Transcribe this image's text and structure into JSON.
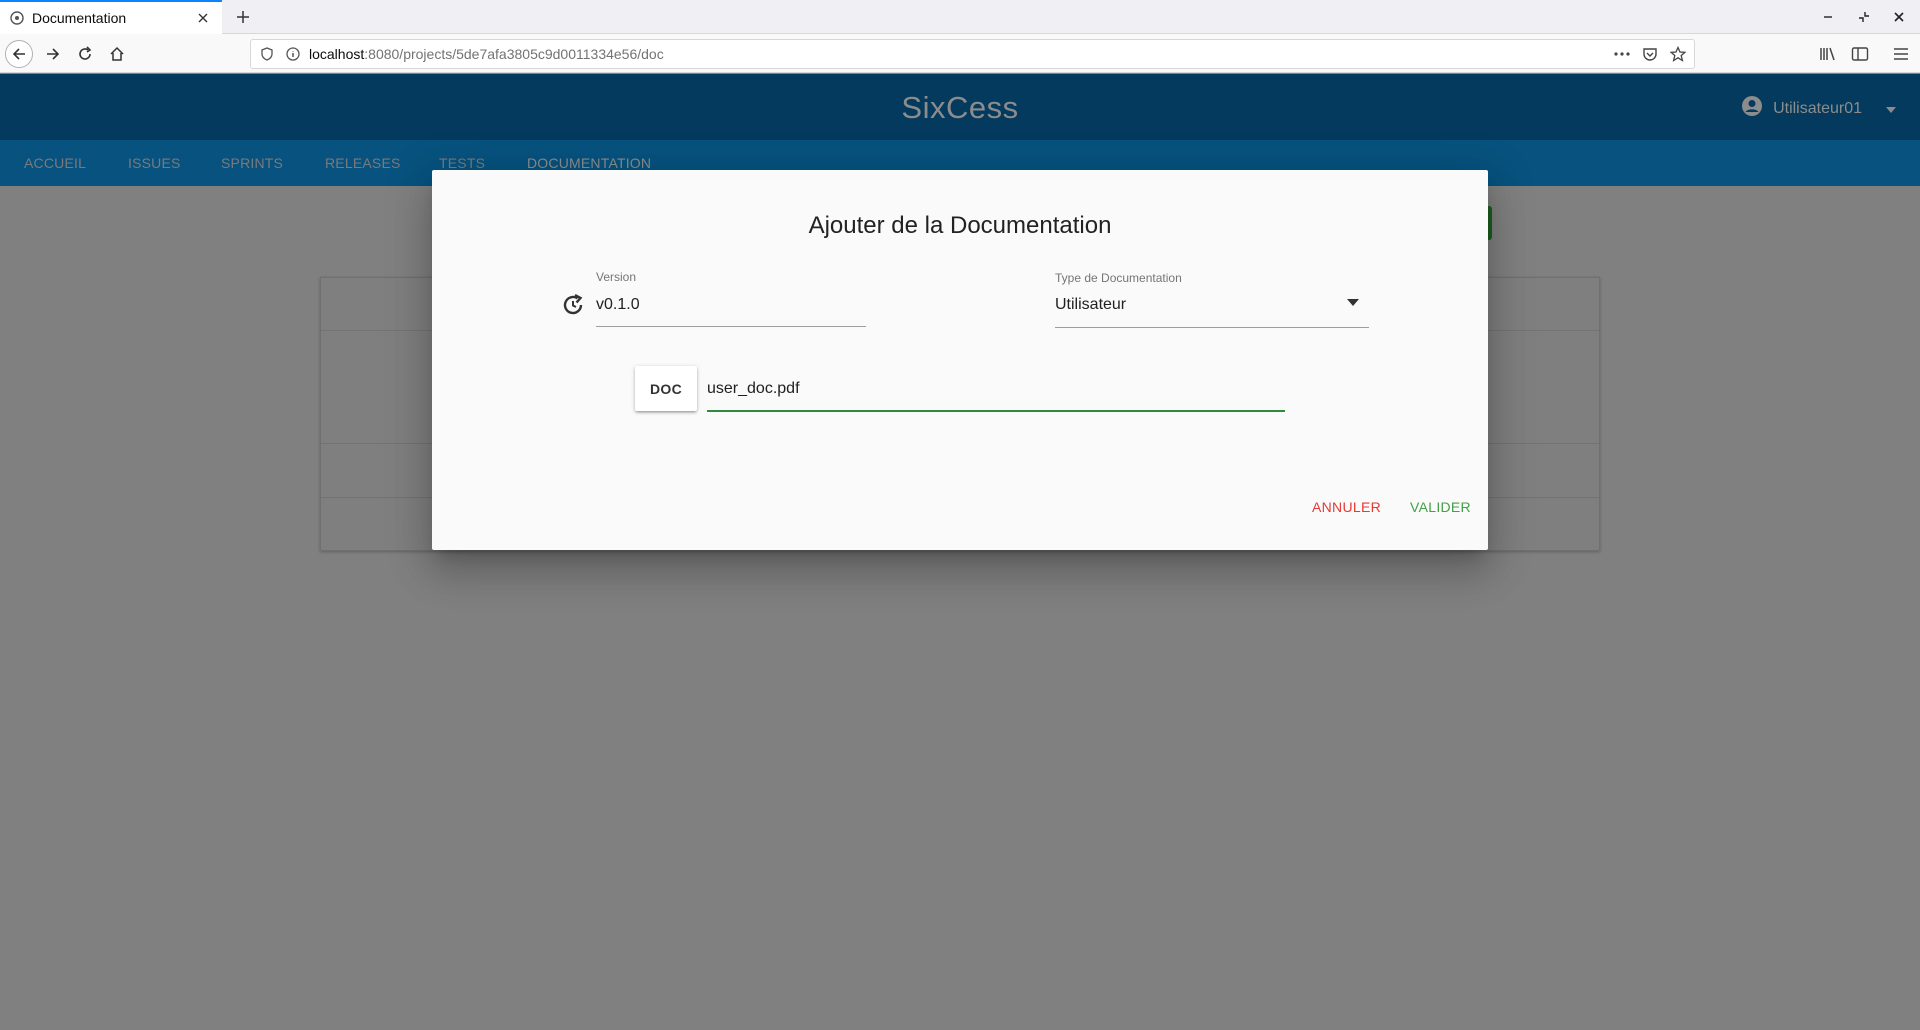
{
  "browser": {
    "tab_title": "Documentation",
    "url_host": "localhost",
    "url_path": ":8080/projects/5de7afa3805c9d0011334e56/doc"
  },
  "app": {
    "title": "SixCess",
    "user_name": "Utilisateur01",
    "nav": [
      "ACCUEIL",
      "ISSUES",
      "SPRINTS",
      "RELEASES",
      "TESTS",
      "DOCUMENTATION"
    ]
  },
  "dialog": {
    "title": "Ajouter de la Documentation",
    "version_label": "Version",
    "version_value": "v0.1.0",
    "type_label": "Type de Documentation",
    "type_value": "Utilisateur",
    "doc_button": "DOC",
    "file_value": "user_doc.pdf",
    "cancel_label": "ANNULER",
    "submit_label": "VALIDER"
  },
  "colors": {
    "header": "#043a5e",
    "nav": "#07527e",
    "overlay": "#808080",
    "cancel": "#e53935",
    "submit": "#43a047",
    "focus_underline": "#2e8b3e"
  }
}
